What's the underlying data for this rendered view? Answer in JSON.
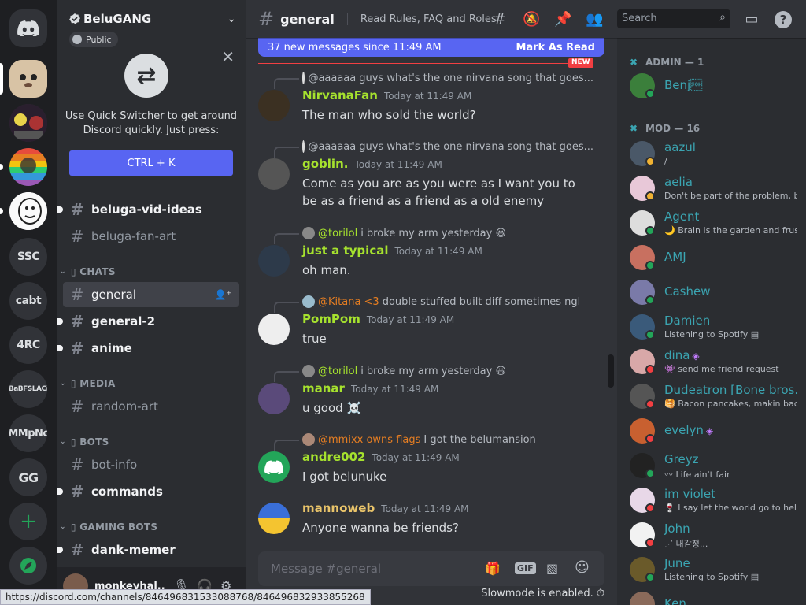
{
  "rail": {
    "servers": [
      {
        "label": "",
        "kind": "home"
      },
      {
        "label": "",
        "kind": "image",
        "color": "#c9a98b"
      },
      {
        "label": "",
        "kind": "image",
        "color": "#3a2a3a"
      },
      {
        "label": "",
        "kind": "image",
        "color": "#8e44ad"
      },
      {
        "label": "",
        "kind": "image",
        "color": "#f2f2f2"
      },
      {
        "label": "SSC",
        "kind": "text"
      },
      {
        "label": "cabt",
        "kind": "text"
      },
      {
        "label": "4RC",
        "kind": "text"
      },
      {
        "label": "BaBFSLACi",
        "kind": "text"
      },
      {
        "label": "MMpNc",
        "kind": "text"
      },
      {
        "label": "GG",
        "kind": "text"
      }
    ]
  },
  "guild": {
    "name": "BeluGANG",
    "public_label": "Public"
  },
  "quick_switcher": {
    "description": "Use Quick Switcher to get around Discord quickly. Just press:",
    "shortcut": "CTRL + K"
  },
  "channels": {
    "top": [
      {
        "name": "beluga-vid-ideas",
        "unread": true
      },
      {
        "name": "beluga-fan-art",
        "unread": false
      }
    ],
    "categories": [
      {
        "name": "▯ CHATS",
        "items": [
          {
            "name": "general",
            "selected": true
          },
          {
            "name": "general-2",
            "unread": true
          },
          {
            "name": "anime",
            "unread": true
          }
        ]
      },
      {
        "name": "▯ MEDIA",
        "items": [
          {
            "name": "random-art",
            "unread": false
          }
        ]
      },
      {
        "name": "▯ BOTS",
        "items": [
          {
            "name": "bot-info",
            "unread": false
          },
          {
            "name": "commands",
            "unread": true
          }
        ]
      },
      {
        "name": "▯ GAMING BOTS",
        "items": [
          {
            "name": "dank-memer",
            "unread": true
          }
        ]
      }
    ]
  },
  "user_panel": {
    "username": "monkeyhal..."
  },
  "chat": {
    "channel": "general",
    "topic": "Read Rules, FAQ and Roles...",
    "search_placeholder": "Search",
    "new_messages": "37 new messages since 11:49 AM",
    "mark_as_read": "Mark As Read",
    "new_tag": "NEW",
    "composer_placeholder": "Message #general",
    "slowmode": "Slowmode is enabled.",
    "messages": [
      {
        "reply_name": "@aaaaaa",
        "reply_color": "#b5bac1",
        "reply_text": "guys what's the one nirvana song that goes...",
        "author": "NirvanaFan",
        "author_color": "#a6e22e",
        "time": "Today at 11:49 AM",
        "body": "The man who sold the world?"
      },
      {
        "reply_name": "@aaaaaa",
        "reply_color": "#b5bac1",
        "reply_text": "guys what's the one nirvana song that goes...",
        "author": "goblin.",
        "author_color": "#a6e22e",
        "time": "Today at 11:49 AM",
        "body": "Come as you are as you were as I want you to be as a friend as a friend as a old enemy"
      },
      {
        "reply_name": "@torilol",
        "reply_color": "#a6e22e",
        "reply_text": "i broke my arm yesterday 😃",
        "author": "just a typical",
        "author_color": "#a6e22e",
        "time": "Today at 11:49 AM",
        "body": "oh man."
      },
      {
        "reply_name": "@Kitana <3",
        "reply_color": "#e67e22",
        "reply_text": "double stuffed built diff sometimes ngl",
        "author": "PomPom",
        "author_color": "#a6e22e",
        "time": "Today at 11:49 AM",
        "body": "true"
      },
      {
        "reply_name": "@torilol",
        "reply_color": "#a6e22e",
        "reply_text": "i broke my arm yesterday 😃",
        "author": "manar",
        "author_color": "#a6e22e",
        "time": "Today at 11:49 AM",
        "body": "u good ☠️"
      },
      {
        "reply_name": "@mmixx owns flags",
        "reply_color": "#e67e22",
        "reply_text": "I got the belumansion",
        "author": "andre002",
        "author_color": "#a6e22e",
        "time": "Today at 11:49 AM",
        "body": "I got belunuke"
      },
      {
        "reply_name": "",
        "reply_color": "",
        "reply_text": "",
        "author": "mannoweb",
        "author_color": "#e9c46a",
        "time": "Today at 11:49 AM",
        "body": "Anyone wanna be friends?"
      }
    ]
  },
  "members": {
    "admin_header": "ADMIN — 1",
    "mod_header": "MOD — 16",
    "admins": [
      {
        "name": "Benj\u0001",
        "sub": "",
        "status": "#23a559",
        "color": "#3ba5b2"
      }
    ],
    "mods": [
      {
        "name": "aazul",
        "sub": "/",
        "status": "#f0b232",
        "gem": false
      },
      {
        "name": "aelia",
        "sub": "Don't be part of the problem, b...",
        "status": "#f0b232",
        "gem": false
      },
      {
        "name": "Agent",
        "sub": "🌙 Brain is the garden and frus...",
        "status": "#23a559",
        "gem": false
      },
      {
        "name": "AMJ",
        "sub": "",
        "status": "#23a559",
        "gem": false
      },
      {
        "name": "Cashew",
        "sub": "",
        "status": "#23a559",
        "gem": false
      },
      {
        "name": "Damien",
        "sub": "Listening to Spotify ▤",
        "status": "#23a559",
        "gem": false
      },
      {
        "name": "dina",
        "sub": "👾 send me friend request",
        "status": "#f23f42",
        "gem": true
      },
      {
        "name": "Dudeatron [Bone bros...",
        "sub": "🥞 Bacon pancakes, makin bac...",
        "status": "#f23f42",
        "gem": false
      },
      {
        "name": "evelyn",
        "sub": "",
        "status": "#f23f42",
        "gem": true
      },
      {
        "name": "Greyz",
        "sub": "〰 Life ain't fair",
        "status": "#23a559",
        "gem": false
      },
      {
        "name": "im violet",
        "sub": "🍷 I say let the world go to hell...",
        "status": "#f23f42",
        "gem": false
      },
      {
        "name": "John",
        "sub": "⋰ 내감정...",
        "status": "#f23f42",
        "gem": false
      },
      {
        "name": "June",
        "sub": "Listening to Spotify ▤",
        "status": "#23a559",
        "gem": false
      },
      {
        "name": "Ken",
        "sub": "",
        "status": "#23a559",
        "gem": false
      }
    ]
  },
  "status_bar": {
    "url": "https://discord.com/channels/846496831533088768/846496832933855268"
  }
}
